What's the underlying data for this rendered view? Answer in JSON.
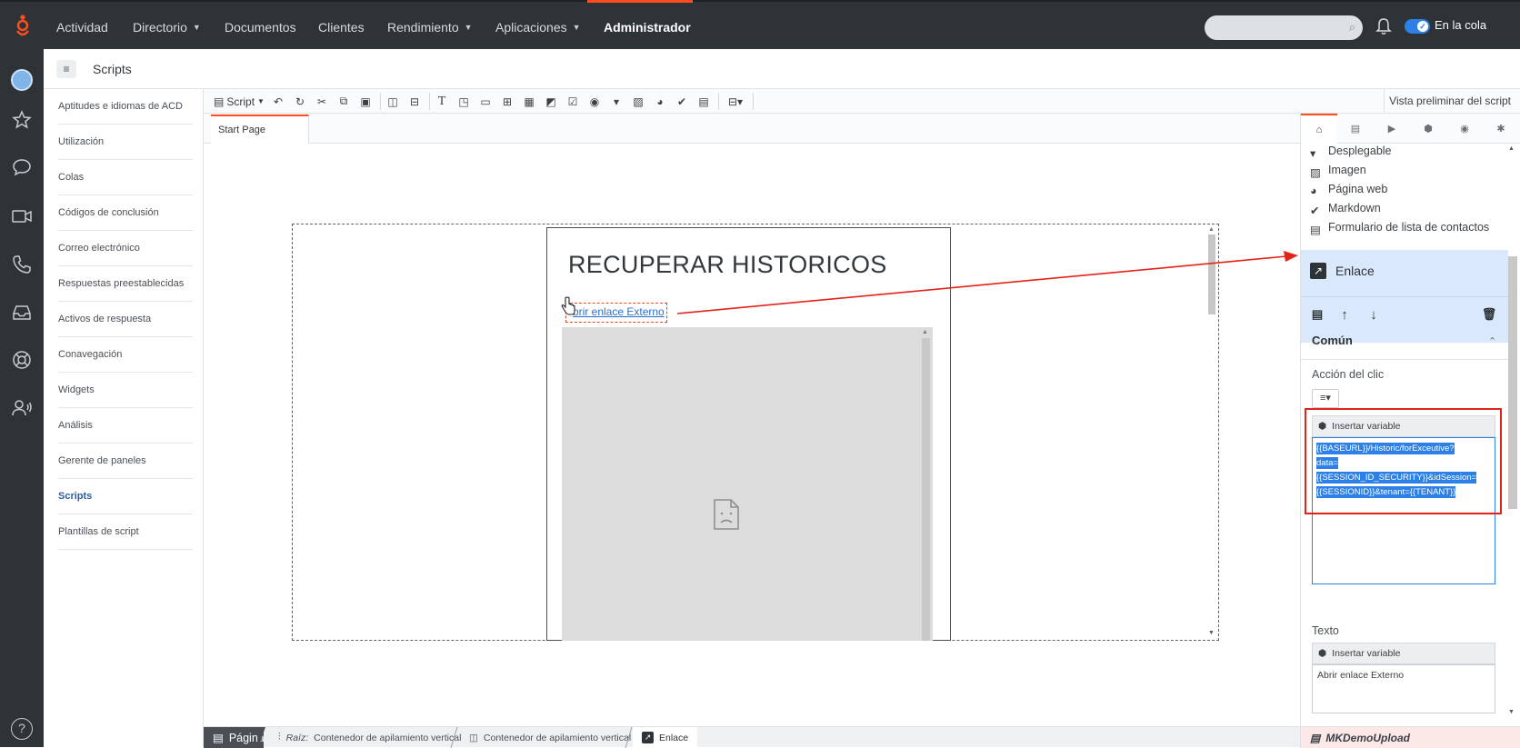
{
  "topnav": {
    "items": [
      {
        "label": "Actividad",
        "dropdown": false
      },
      {
        "label": "Directorio",
        "dropdown": true
      },
      {
        "label": "Documentos",
        "dropdown": false
      },
      {
        "label": "Clientes",
        "dropdown": false
      },
      {
        "label": "Rendimiento",
        "dropdown": true
      },
      {
        "label": "Aplicaciones",
        "dropdown": true
      },
      {
        "label": "Administrador",
        "dropdown": false,
        "active": true
      }
    ],
    "search_placeholder": "",
    "queue_status": "En la cola",
    "accent_color": "#ff4f1f"
  },
  "leftrail": {
    "icons": [
      "avatar",
      "star-icon",
      "chat-icon",
      "video-icon",
      "phone-icon",
      "inbox-icon",
      "lifebuoy-icon",
      "voice-user-icon",
      "help-icon"
    ],
    "help_label": "?"
  },
  "breadcrumb": {
    "title": "Scripts"
  },
  "sidenav": {
    "items": [
      {
        "label": "Aptitudes e idiomas de ACD"
      },
      {
        "label": "Utilización"
      },
      {
        "label": "Colas"
      },
      {
        "label": "Códigos de conclusión"
      },
      {
        "label": "Correo electrónico"
      },
      {
        "label": "Respuestas preestablecidas"
      },
      {
        "label": "Activos de respuesta"
      },
      {
        "label": "Conavegación"
      },
      {
        "label": "Widgets"
      },
      {
        "label": "Análisis"
      },
      {
        "label": "Gerente de paneles"
      },
      {
        "label": "Scripts",
        "selected": true
      },
      {
        "label": "Plantillas de script"
      }
    ]
  },
  "toolbar": {
    "script_menu": "Script",
    "preview_label": "Vista preliminar del script"
  },
  "tabs": {
    "start_page": "Start Page"
  },
  "canvas": {
    "heading": "RECUPERAR HISTORICOS",
    "link_text": "Abrir enlace Externo",
    "link_visible": "brir enlace Externo"
  },
  "rpanel": {
    "components": [
      {
        "label": "Desplegable",
        "icon": "dropdown-icon"
      },
      {
        "label": "Imagen",
        "icon": "image-icon"
      },
      {
        "label": "Página web",
        "icon": "globe-icon"
      },
      {
        "label": "Markdown",
        "icon": "markdown-icon"
      },
      {
        "label": "Formulario de lista de contactos",
        "icon": "form-icon"
      }
    ],
    "selected_component": "Enlace",
    "section_title": "Común",
    "click_action_label": "Acción del clic",
    "insert_variable": "Insertar variable",
    "click_action_value": "{{BASEURL}}/Historic/forExceutive?data={{SESSION_ID_SECURITY}}&idSession={{SESSIONID}}&tenant={{TENANT}}",
    "click_action_lines": [
      "{{BASEURL}}/Historic/forExceutive?",
      "data=",
      "{{SESSION_ID_SECURITY}}&idSession=",
      "{{SESSIONID}}&tenant={{TENANT}}"
    ],
    "text_label": "Texto",
    "text_value": "Abrir enlace Externo",
    "highlight_color": "#2c80e6",
    "annotation_color": "#e2231a"
  },
  "statusbar": {
    "crumbs": [
      {
        "label": "Página",
        "icon": "page-icon"
      },
      {
        "prefix": "Raíz:",
        "label": "Contenedor de apilamiento vertical",
        "icon": "tree-icon"
      },
      {
        "label": "Contenedor de apilamiento vertical",
        "icon": "container-icon"
      },
      {
        "label": "Enlace",
        "icon": "link-icon"
      }
    ],
    "script_name": "MKDemoUpload"
  }
}
